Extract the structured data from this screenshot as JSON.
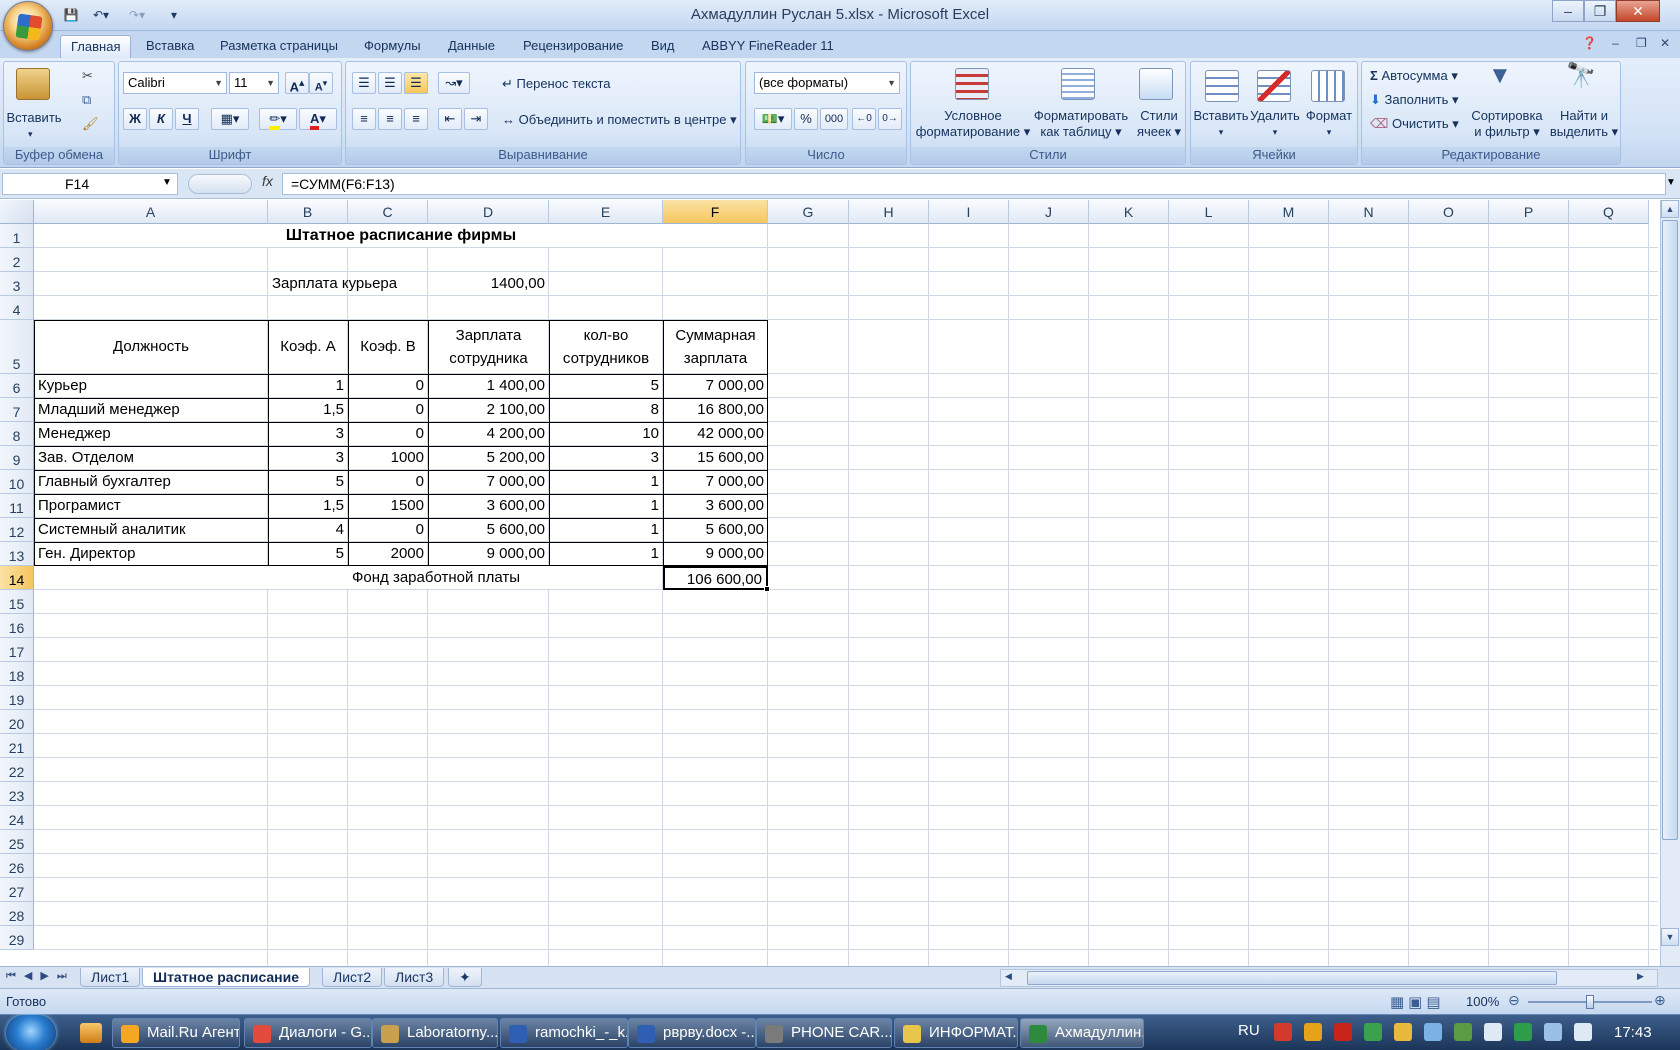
{
  "window": {
    "title": "Ахмадуллин Руслан 5.xlsx - Microsoft Excel"
  },
  "ribbon_tabs": [
    "Главная",
    "Вставка",
    "Разметка страницы",
    "Формулы",
    "Данные",
    "Рецензирование",
    "Вид",
    "ABBYY FineReader 11"
  ],
  "ribbon": {
    "clipboard": {
      "label": "Буфер обмена",
      "paste": "Вставить"
    },
    "font": {
      "label": "Шрифт",
      "name": "Calibri",
      "size": "11",
      "bold": "Ж",
      "italic": "К",
      "underline": "Ч"
    },
    "alignment": {
      "label": "Выравнивание",
      "wrap": "Перенос текста",
      "merge": "Объединить и поместить в центре"
    },
    "number": {
      "label": "Число",
      "format": "(все форматы)",
      "percent": "%",
      "thousands": "000"
    },
    "styles": {
      "label": "Стили",
      "conditional": [
        "Условное",
        "форматирование"
      ],
      "as_table": [
        "Форматировать",
        "как таблицу"
      ],
      "cell_styles": [
        "Стили",
        "ячеек"
      ]
    },
    "cells": {
      "label": "Ячейки",
      "insert": "Вставить",
      "delete": "Удалить",
      "format": "Формат"
    },
    "editing": {
      "label": "Редактирование",
      "autosum": "Автосумма",
      "fill": "Заполнить",
      "clear": "Очистить",
      "sort": [
        "Сортировка",
        "и фильтр"
      ],
      "find": [
        "Найти и",
        "выделить"
      ]
    }
  },
  "formula_bar": {
    "name_box": "F14",
    "fx": "fx",
    "formula": "=СУММ(F6:F13)"
  },
  "columns": [
    "A",
    "B",
    "C",
    "D",
    "E",
    "F",
    "G",
    "H",
    "I",
    "J",
    "K",
    "L",
    "M",
    "N",
    "O",
    "P",
    "Q"
  ],
  "rows": [
    "1",
    "2",
    "3",
    "4",
    "5",
    "6",
    "7",
    "8",
    "9",
    "10",
    "11",
    "12",
    "13",
    "14",
    "15",
    "16",
    "17",
    "18",
    "19",
    "20",
    "21",
    "22",
    "23",
    "24",
    "25",
    "26",
    "27",
    "28",
    "29"
  ],
  "sheet": {
    "title": "Штатное расписание фирмы",
    "courier_label": "Зарплата курьера",
    "courier_value": "1400,00",
    "headers": {
      "pos": "Должность",
      "ka": "Коэф. А",
      "kb": "Коэф. В",
      "sal1": "Зарплата",
      "sal2": "сотрудника",
      "cnt1": "кол-во",
      "cnt2": "сотрудников",
      "sum1": "Суммарная",
      "sum2": "зарплата"
    },
    "data": [
      [
        "Курьер",
        "1",
        "0",
        "1 400,00",
        "5",
        "7 000,00"
      ],
      [
        "Младший менеджер",
        "1,5",
        "0",
        "2 100,00",
        "8",
        "16 800,00"
      ],
      [
        "Менеджер",
        "3",
        "0",
        "4 200,00",
        "10",
        "42 000,00"
      ],
      [
        "Зав. Отделом",
        "3",
        "1000",
        "5 200,00",
        "3",
        "15 600,00"
      ],
      [
        "Главный бухгалтер",
        "5",
        "0",
        "7 000,00",
        "1",
        "7 000,00"
      ],
      [
        "Програмист",
        "1,5",
        "1500",
        "3 600,00",
        "1",
        "3 600,00"
      ],
      [
        "Системный аналитик",
        "4",
        "0",
        "5 600,00",
        "1",
        "5 600,00"
      ],
      [
        "Ген. Директор",
        "5",
        "2000",
        "9 000,00",
        "1",
        "9 000,00"
      ]
    ],
    "fund_label": "Фонд заработной платы",
    "fund_value": "106 600,00"
  },
  "sheet_tabs": [
    "Лист1",
    "Штатное расписание",
    "Лист2",
    "Лист3"
  ],
  "status": {
    "ready": "Готово",
    "zoom": "100%"
  },
  "taskbar": {
    "items": [
      "Mail.Ru Агент",
      "Диалоги - G...",
      "Laboratorny...",
      "ramochki_-_k...",
      "рврву.docx -...",
      "PHONE CAR...",
      "ИНФОРМАТ...",
      "Ахмадуллин..."
    ],
    "lang": "RU",
    "time": "17:43"
  }
}
